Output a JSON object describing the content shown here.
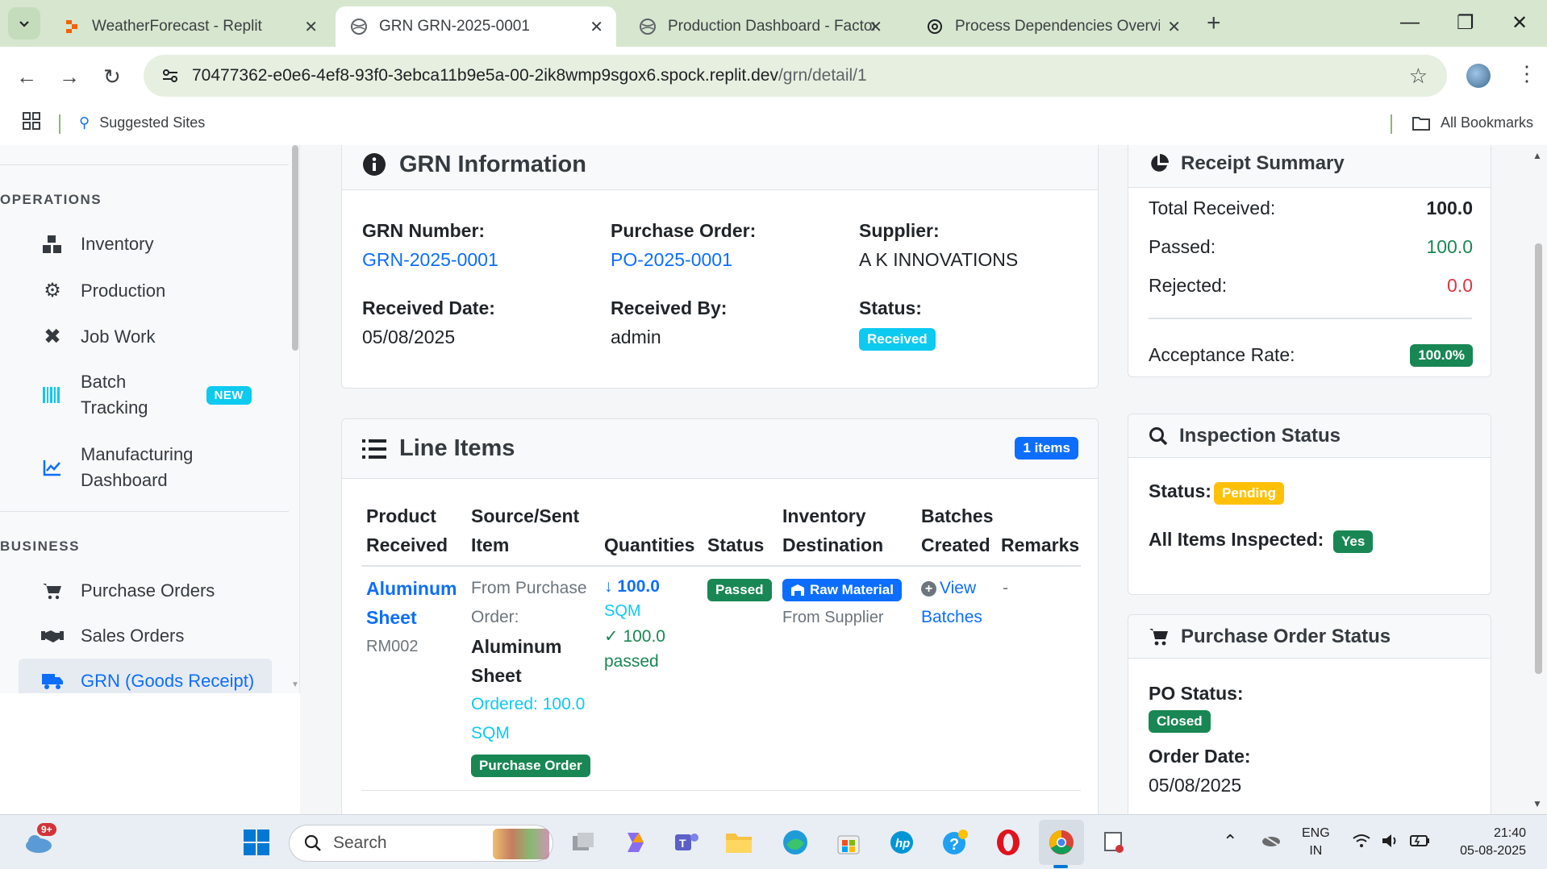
{
  "browser": {
    "tabs": [
      {
        "title": "WeatherForecast - Replit",
        "active": false
      },
      {
        "title": "GRN GRN-2025-0001",
        "active": true
      },
      {
        "title": "Production Dashboard - Factory",
        "active": false
      },
      {
        "title": "Process Dependencies Overview",
        "active": false
      }
    ],
    "url_host": "70477362-e0e6-4ef8-93f0-3ebca11b9e5a-00-2ik8wmp9sgox6.spock.replit.dev",
    "url_path": "/grn/detail/1",
    "bookmarks": {
      "suggested": "Suggested Sites",
      "all": "All Bookmarks"
    }
  },
  "sidebar": {
    "operations_title": "OPERATIONS",
    "operations": [
      {
        "label": "Inventory"
      },
      {
        "label": "Production"
      },
      {
        "label": "Job Work"
      },
      {
        "label": "Batch Tracking",
        "line1": "Batch",
        "line2": "Tracking",
        "badge": "NEW"
      },
      {
        "label": "Manufacturing Dashboard",
        "line1": "Manufacturing",
        "line2": "Dashboard"
      }
    ],
    "business_title": "BUSINESS",
    "business": [
      {
        "label": "Purchase Orders"
      },
      {
        "label": "Sales Orders"
      },
      {
        "label": "GRN (Goods Receipt)"
      }
    ]
  },
  "grn_info": {
    "title": "GRN Information",
    "grn_number_label": "GRN Number:",
    "grn_number": "GRN-2025-0001",
    "po_label": "Purchase Order:",
    "po": "PO-2025-0001",
    "supplier_label": "Supplier:",
    "supplier": "A K INNOVATIONS",
    "received_date_label": "Received Date:",
    "received_date": "05/08/2025",
    "received_by_label": "Received By:",
    "received_by": "admin",
    "status_label": "Status:",
    "status": "Received"
  },
  "line_items": {
    "title": "Line Items",
    "count_badge": "1 items",
    "headers": {
      "product_1": "Product",
      "product_2": "Received",
      "source_1": "Source/Sent",
      "source_2": "Item",
      "quantities": "Quantities",
      "status": "Status",
      "inv_1": "Inventory",
      "inv_2": "Destination",
      "batches_1": "Batches",
      "batches_2": "Created",
      "remarks": "Remarks"
    },
    "row": {
      "product_1": "Aluminum",
      "product_2": "Sheet",
      "product_code": "RM002",
      "source_1": "From Purchase",
      "source_2": "Order:",
      "source_item_1": "Aluminum",
      "source_item_2": "Sheet",
      "ordered_1": "Ordered: 100.0",
      "ordered_2": "SQM",
      "source_badge": "Purchase Order",
      "qty_received": "100.0",
      "qty_unit": "SQM",
      "qty_passed": "100.0",
      "qty_passed_label": "passed",
      "status": "Passed",
      "inventory_badge": "Raw Material",
      "inventory_from": "From Supplier",
      "batches_1": "View",
      "batches_2": "Batches",
      "remarks": "-"
    }
  },
  "receipt_summary": {
    "title": "Receipt Summary",
    "total_label": "Total Received:",
    "total": "100.0",
    "passed_label": "Passed:",
    "passed": "100.0",
    "rejected_label": "Rejected:",
    "rejected": "0.0",
    "acceptance_label": "Acceptance Rate:",
    "acceptance": "100.0%"
  },
  "inspection": {
    "title": "Inspection Status",
    "status_label": "Status:",
    "status": "Pending",
    "all_label": "All Items Inspected:",
    "all_value": "Yes"
  },
  "po_status": {
    "title": "Purchase Order Status",
    "po_status_label": "PO Status:",
    "po_status": "Closed",
    "order_date_label": "Order Date:",
    "order_date": "05/08/2025"
  },
  "taskbar": {
    "search_placeholder": "Search",
    "notif_badge": "9+",
    "lang_1": "ENG",
    "lang_2": "IN",
    "time": "21:40",
    "date": "05-08-2025"
  },
  "colors": {
    "primary": "#0d6efd",
    "success": "#198754",
    "danger": "#dc3545",
    "info": "#0dcaf0",
    "warning": "#ffc107"
  }
}
